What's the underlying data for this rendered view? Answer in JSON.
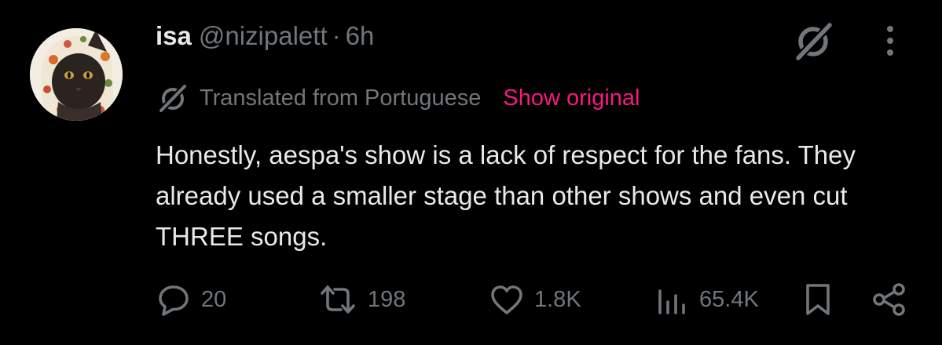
{
  "author": {
    "display_name": "isa",
    "handle": "@nizipalett",
    "separator": "·",
    "timestamp": "6h"
  },
  "translation": {
    "label": "Translated from Portuguese",
    "show_original": "Show original"
  },
  "body": "Honestly, aespa's show is a lack of respect for the fans. They already used a smaller stage than other shows and even cut THREE songs.",
  "actions": {
    "replies": "20",
    "reposts": "198",
    "likes": "1.8K",
    "views": "65.4K"
  },
  "icons": {
    "grok": "grok-icon",
    "more": "more-dots-icon",
    "translate": "grok-translate-icon",
    "reply": "reply-icon",
    "repost": "repost-icon",
    "like": "heart-icon",
    "views": "views-chart-icon",
    "bookmark": "bookmark-icon",
    "share": "share-icon"
  },
  "colors": {
    "background": "#000000",
    "primary_text": "#e7e9ea",
    "secondary_text": "#71767b",
    "accent_pink": "#f91880"
  }
}
